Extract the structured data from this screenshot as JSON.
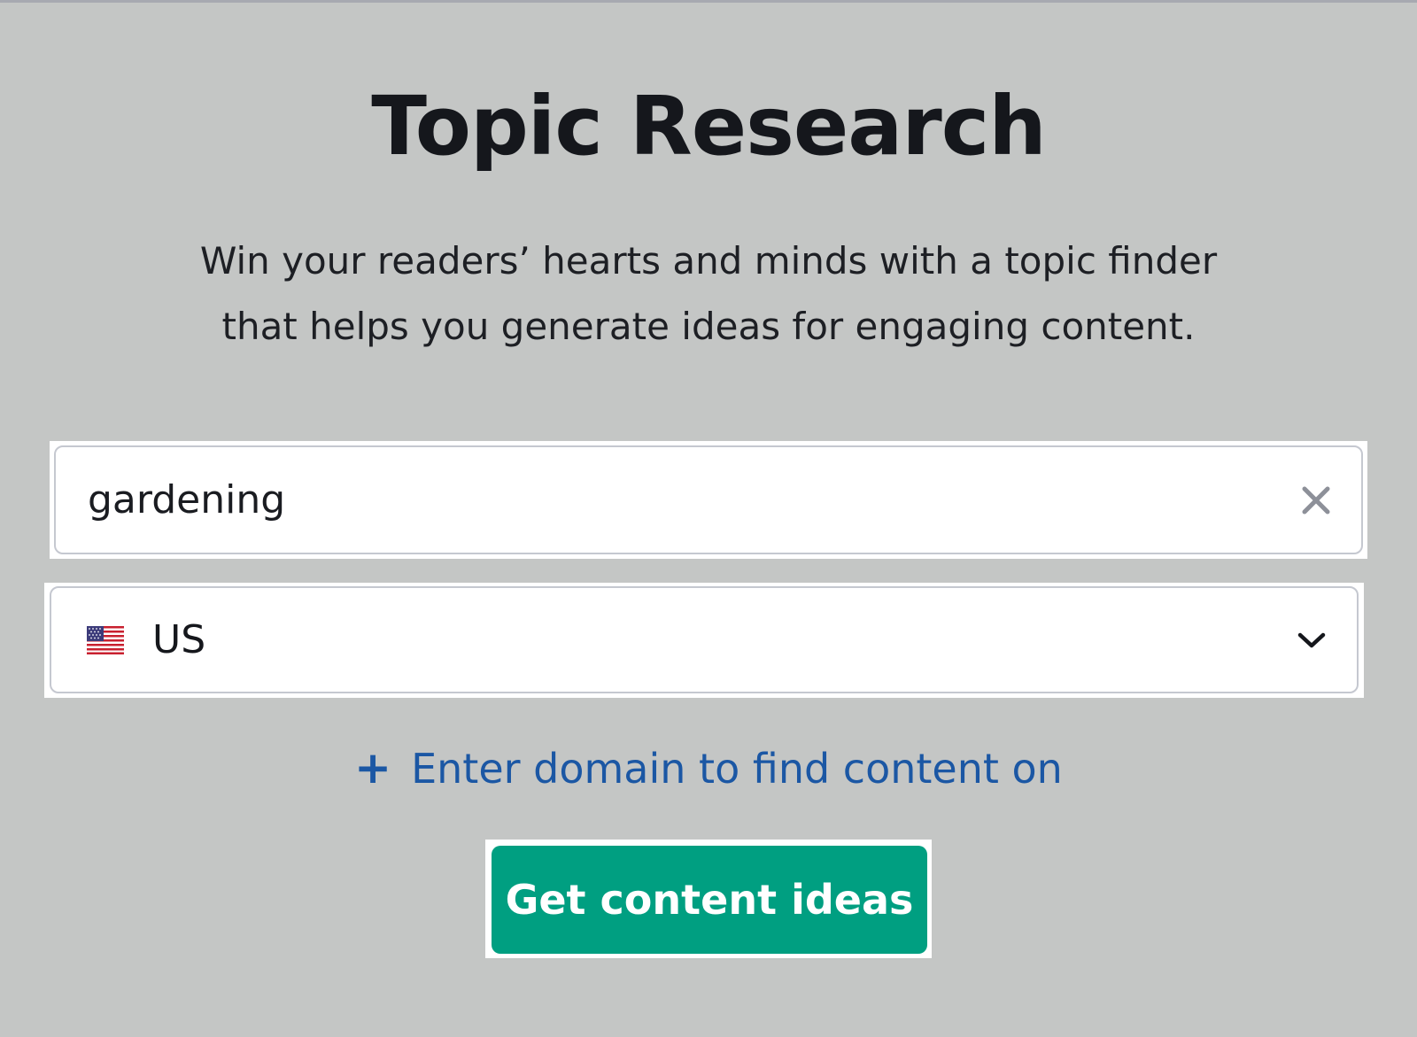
{
  "header": {
    "title": "Topic Research",
    "subtitle_line1": "Win your readers’ hearts and minds with a topic finder",
    "subtitle_line2": "that helps you generate ideas for engaging content."
  },
  "form": {
    "keyword": {
      "value": "gardening",
      "clear_icon": "close-icon"
    },
    "country": {
      "selected": "US",
      "flag_icon": "us-flag-icon",
      "dropdown_icon": "chevron-down-icon"
    },
    "domain_link": {
      "icon": "plus-icon",
      "label": "Enter domain to find content on"
    },
    "submit_label": "Get content ideas"
  },
  "colors": {
    "background": "#c4c6c5",
    "link": "#1b57a4",
    "cta": "#009f81"
  }
}
